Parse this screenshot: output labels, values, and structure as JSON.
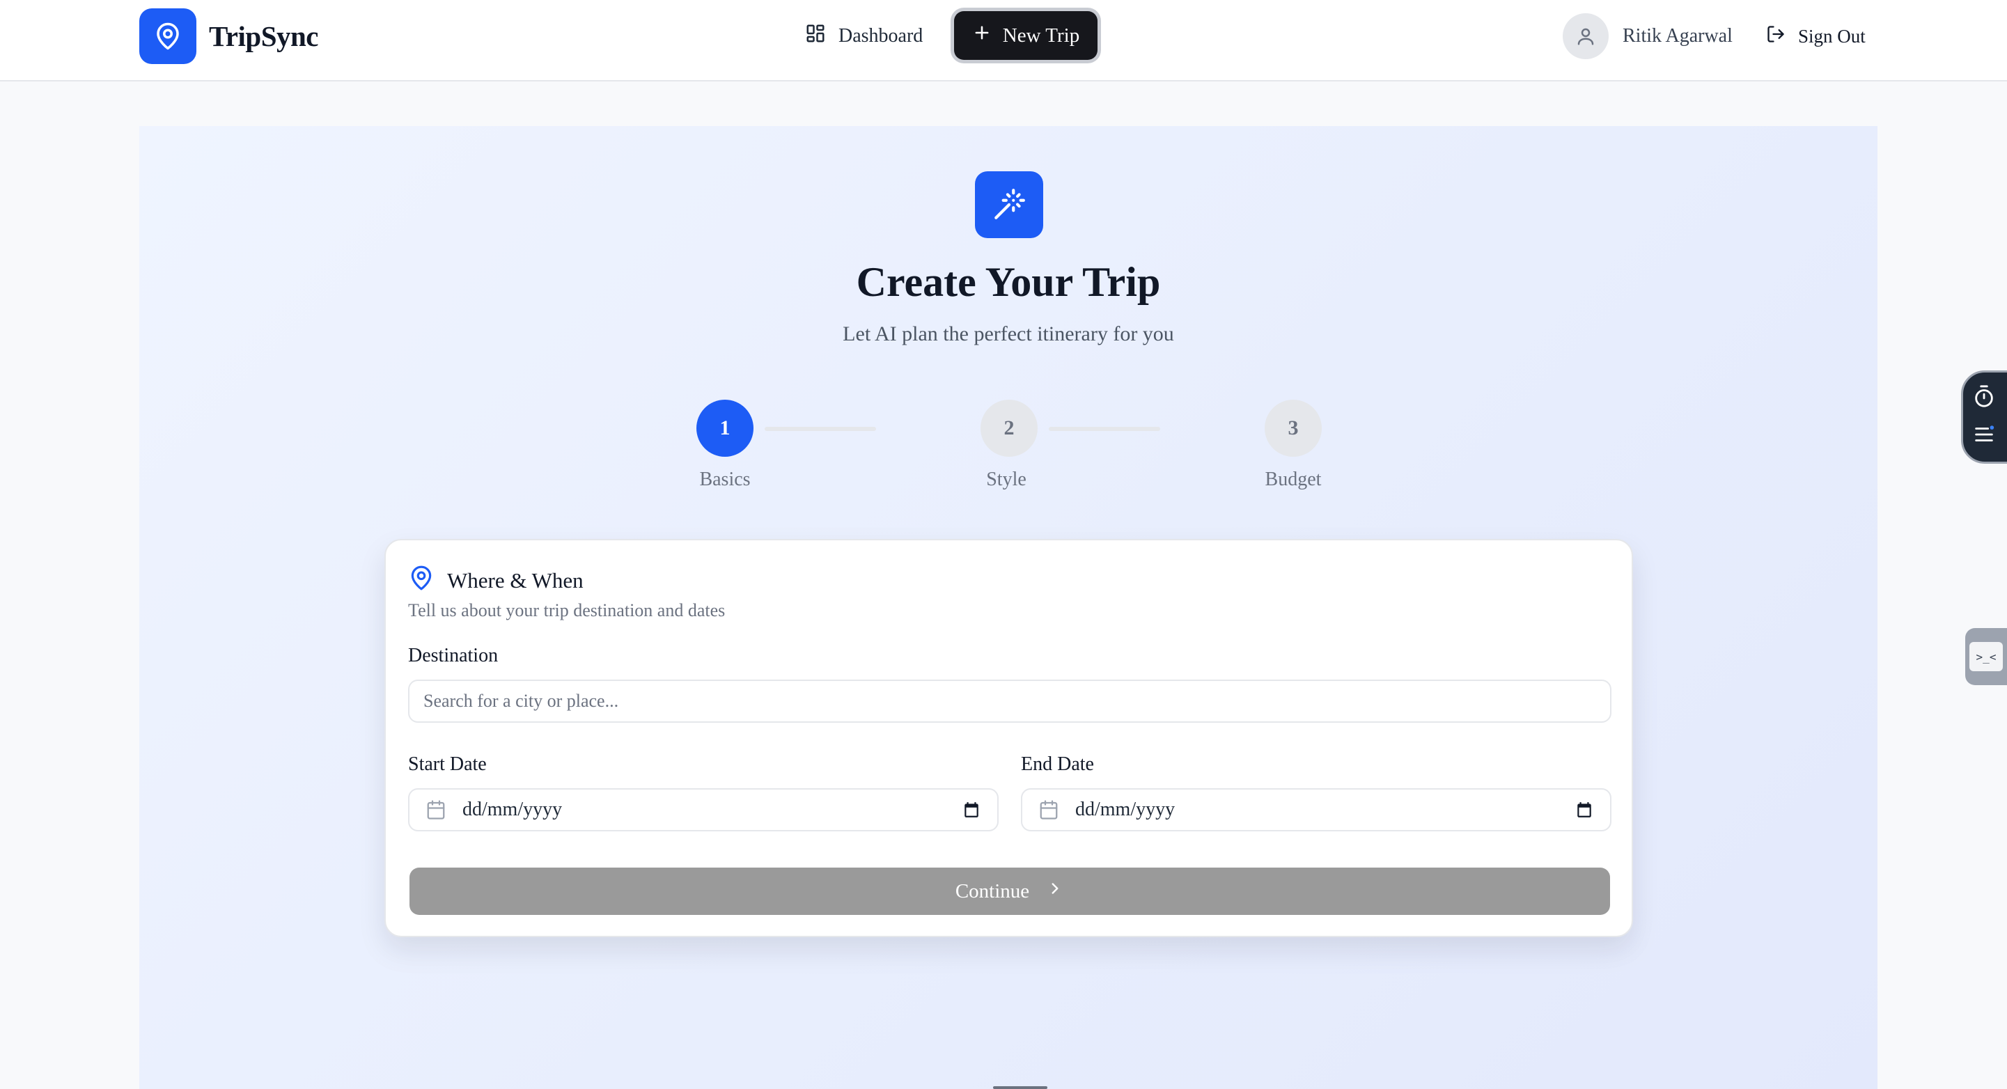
{
  "header": {
    "brand_name": "TripSync",
    "nav": {
      "dashboard_label": "Dashboard",
      "new_trip_label": "New Trip"
    },
    "user_name": "Ritik Agarwal",
    "sign_out_label": "Sign Out"
  },
  "hero": {
    "title": "Create Your Trip",
    "subtitle": "Let AI plan the perfect itinerary for you"
  },
  "stepper": {
    "current_step": 1,
    "steps": [
      {
        "number": "1",
        "label": "Basics",
        "state": "active"
      },
      {
        "number": "2",
        "label": "Style",
        "state": "inactive"
      },
      {
        "number": "3",
        "label": "Budget",
        "state": "inactive"
      }
    ]
  },
  "form": {
    "section_title": "Where & When",
    "section_description": "Tell us about your trip destination and dates",
    "destination": {
      "label": "Destination",
      "value": "",
      "placeholder": "Search for a city or place..."
    },
    "start_date": {
      "label": "Start Date",
      "value": "dd/mm/yyyy"
    },
    "end_date": {
      "label": "End Date",
      "value": "dd/mm/yyyy"
    },
    "continue_label": "Continue",
    "continue_enabled": false
  },
  "floating_tab": {
    "glyph": ">_<"
  },
  "colors": {
    "primary": "#1d5cf5",
    "dark_button": "#16171c",
    "disabled_button": "#9a9a9a",
    "hero_background": "#e8eefd",
    "muted_text": "#6b7280"
  },
  "icons": {
    "brand": "map-pin-icon",
    "dashboard": "grid-icon",
    "new_trip": "plus-icon",
    "user": "user-icon",
    "sign_out": "logout-icon",
    "hero": "magic-wand-icon",
    "section": "map-pin-icon",
    "date": "calendar-icon",
    "continue": "chevron-right-icon"
  }
}
